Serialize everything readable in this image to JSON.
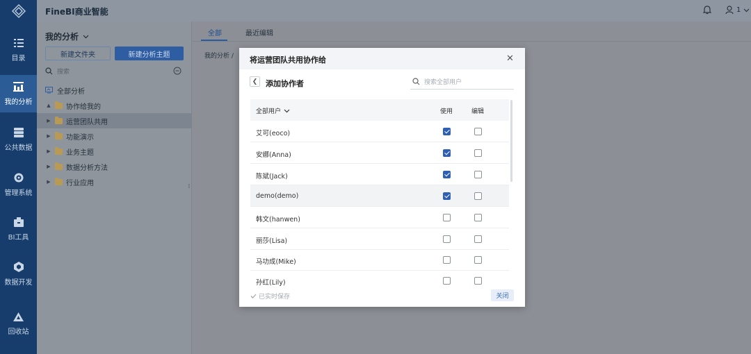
{
  "app": {
    "brand": "FineBI商业智能",
    "user_label": "1"
  },
  "nav": [
    {
      "label": "目录",
      "icon": "catalog-icon"
    },
    {
      "label": "我的分析",
      "icon": "analysis-icon"
    },
    {
      "label": "公共数据",
      "icon": "database-icon"
    },
    {
      "label": "管理系统",
      "icon": "gear-icon"
    },
    {
      "label": "BI工具",
      "icon": "toolbox-icon"
    },
    {
      "label": "数据开发",
      "icon": "cube-icon"
    },
    {
      "label": "回收站",
      "icon": "recycle-icon"
    }
  ],
  "panel": {
    "title": "我的分析",
    "new_folder": "新建文件夹",
    "new_subject": "新建分析主题",
    "search_placeholder": "搜索",
    "tree": [
      {
        "label": "全部分析",
        "level": 0
      },
      {
        "label": "协作给我的",
        "level": 1
      },
      {
        "label": "运营团队共用",
        "level": 1,
        "selected": true
      },
      {
        "label": "功能演示",
        "level": 1
      },
      {
        "label": "业务主题",
        "level": 1
      },
      {
        "label": "数据分析方法",
        "level": 1
      },
      {
        "label": "行业应用",
        "level": 1
      }
    ]
  },
  "main": {
    "tabs": [
      {
        "label": "全部"
      },
      {
        "label": "最近编辑"
      }
    ],
    "breadcrumb": "我的分析 /"
  },
  "modal": {
    "title": "将运营团队共用协作给",
    "subtitle": "添加协作者",
    "search_placeholder": "搜索全部用户",
    "columns": {
      "users": "全部用户",
      "use": "使用",
      "edit": "编辑"
    },
    "rows": [
      {
        "name": "艾可(eoco)",
        "use": true,
        "edit": false
      },
      {
        "name": "安娜(Anna)",
        "use": true,
        "edit": false
      },
      {
        "name": "陈斌(Jack)",
        "use": true,
        "edit": false
      },
      {
        "name": "demo(demo)",
        "use": true,
        "edit": false
      },
      {
        "name": "韩文(hanwen)",
        "use": false,
        "edit": false
      },
      {
        "name": "丽莎(Lisa)",
        "use": false,
        "edit": false
      },
      {
        "name": "马功成(Mike)",
        "use": false,
        "edit": false
      },
      {
        "name": "孙红(Lily)",
        "use": false,
        "edit": false
      }
    ],
    "saved": "已实时保存",
    "close": "关闭"
  }
}
